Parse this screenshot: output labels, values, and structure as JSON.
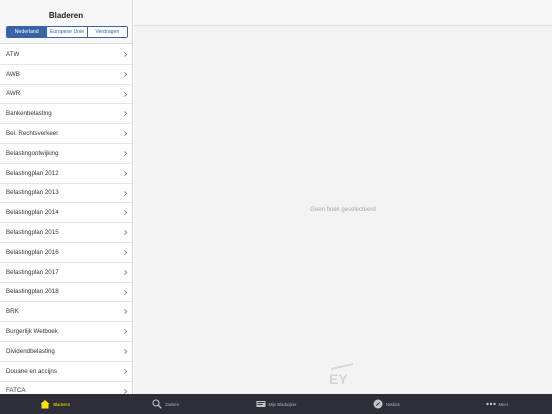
{
  "sidebar": {
    "title": "Bladeren",
    "segments": [
      {
        "label": "Nederland",
        "active": true
      },
      {
        "label": "Europese Unie",
        "active": false
      },
      {
        "label": "Verdragen",
        "active": false
      }
    ],
    "items": [
      {
        "label": "ATW"
      },
      {
        "label": "AWB"
      },
      {
        "label": "AWR"
      },
      {
        "label": "Bankenbelasting"
      },
      {
        "label": "Bel. Rechtsverkeer"
      },
      {
        "label": "Belastingontwijking"
      },
      {
        "label": "Belastingplan 2012"
      },
      {
        "label": "Belastingplan 2013"
      },
      {
        "label": "Belastingplan 2014"
      },
      {
        "label": "Belastingplan 2015"
      },
      {
        "label": "Belastingplan 2016"
      },
      {
        "label": "Belastingplan 2017"
      },
      {
        "label": "Belastingplan 2018"
      },
      {
        "label": "BRK"
      },
      {
        "label": "Burgerlijk Wetboek"
      },
      {
        "label": "Dividendbelasting"
      },
      {
        "label": "Douane en accijns"
      },
      {
        "label": "FATCA"
      }
    ]
  },
  "main": {
    "empty_message": "Geen boek geselecteerd",
    "logo_text": "EY"
  },
  "tabbar": {
    "tabs": [
      {
        "label": "Bladeren",
        "icon": "home-icon",
        "active": true
      },
      {
        "label": "Zoeken",
        "icon": "search-icon",
        "active": false
      },
      {
        "label": "Mijn Bladwijzer",
        "icon": "bookmark-icon",
        "active": false
      },
      {
        "label": "Notities",
        "icon": "note-icon",
        "active": false
      },
      {
        "label": "Meer",
        "icon": "more-icon",
        "active": false
      }
    ],
    "active_color": "#ffe600"
  },
  "colors": {
    "accent": "#3a63a5",
    "tabbar_bg": "#2e2e38"
  }
}
